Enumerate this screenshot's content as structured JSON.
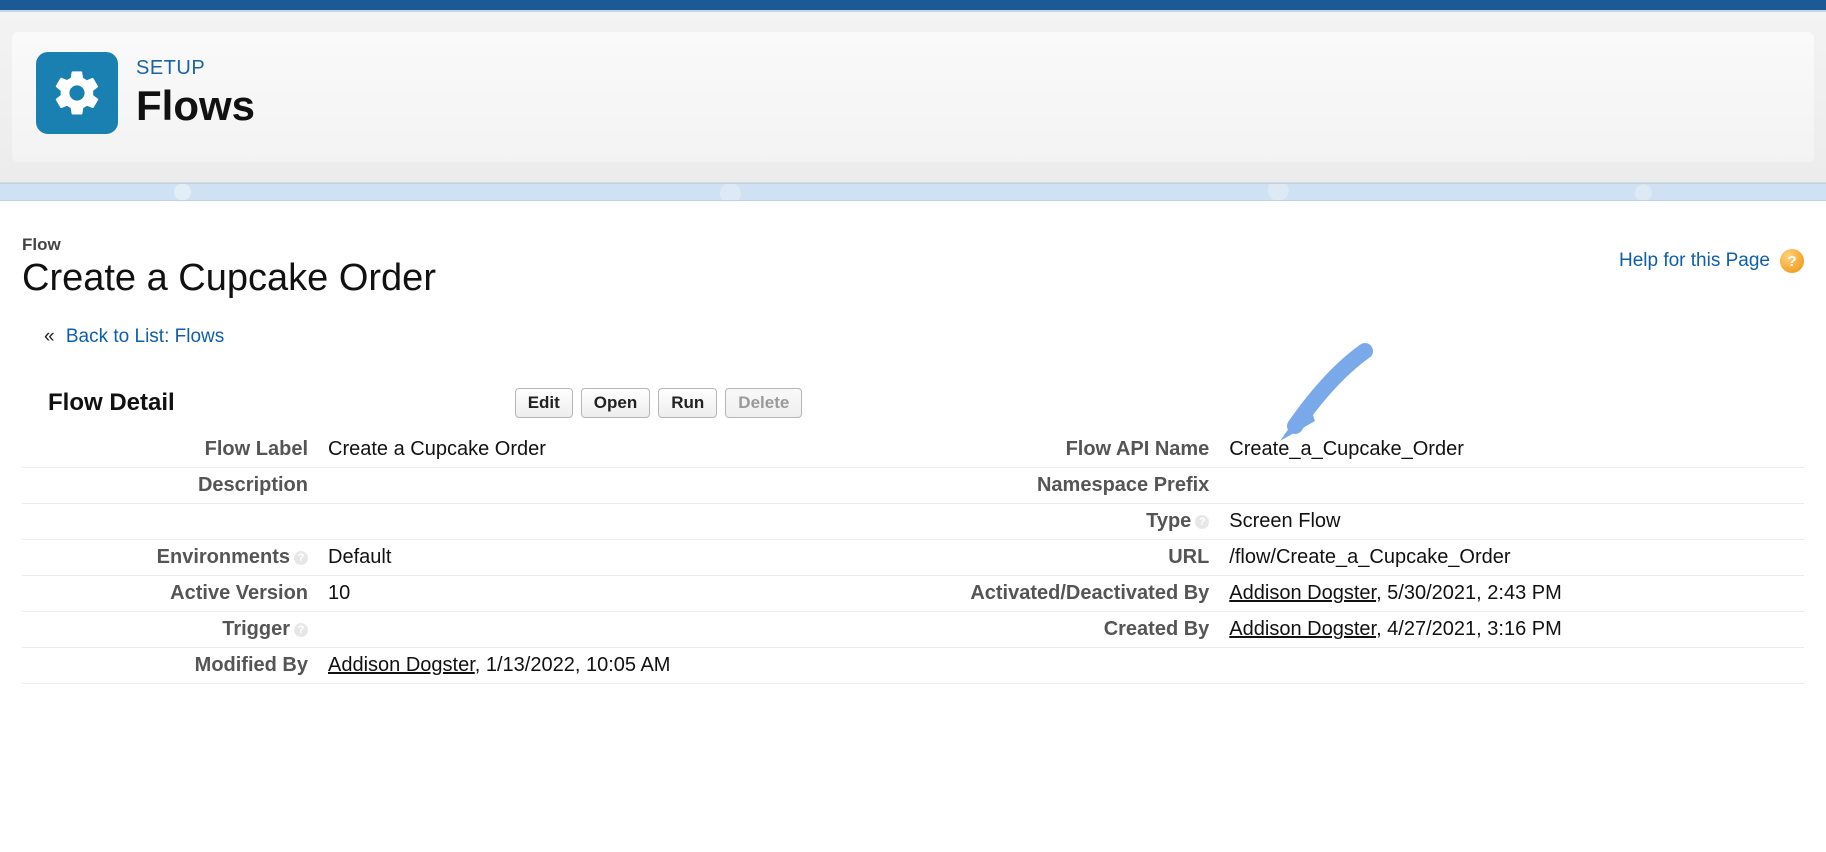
{
  "header": {
    "sup": "SETUP",
    "title": "Flows"
  },
  "page": {
    "object_label": "Flow",
    "title": "Create a Cupcake Order",
    "help_link": "Help for this Page",
    "back_link": "Back to List: Flows"
  },
  "section": {
    "title": "Flow Detail",
    "buttons": {
      "edit": "Edit",
      "open": "Open",
      "run": "Run",
      "delete": "Delete"
    }
  },
  "detail": {
    "flow_label_lbl": "Flow Label",
    "flow_label": "Create a Cupcake Order",
    "flow_api_name_lbl": "Flow API Name",
    "flow_api_name": "Create_a_Cupcake_Order",
    "description_lbl": "Description",
    "description": "",
    "namespace_prefix_lbl": "Namespace Prefix",
    "namespace_prefix": "",
    "type_lbl": "Type",
    "type": "Screen Flow",
    "environments_lbl": "Environments",
    "environments": "Default",
    "url_lbl": "URL",
    "url": "/flow/Create_a_Cupcake_Order",
    "active_version_lbl": "Active Version",
    "active_version": "10",
    "activated_by_lbl": "Activated/Deactivated By",
    "activated_by_user": "Addison Dogster",
    "activated_by_date": ", 5/30/2021, 2:43 PM",
    "trigger_lbl": "Trigger",
    "trigger": "",
    "created_by_lbl": "Created By",
    "created_by_user": "Addison Dogster",
    "created_by_date": ", 4/27/2021, 3:16 PM",
    "modified_by_lbl": "Modified By",
    "modified_by_user": "Addison Dogster",
    "modified_by_date": ", 1/13/2022, 10:05 AM"
  }
}
